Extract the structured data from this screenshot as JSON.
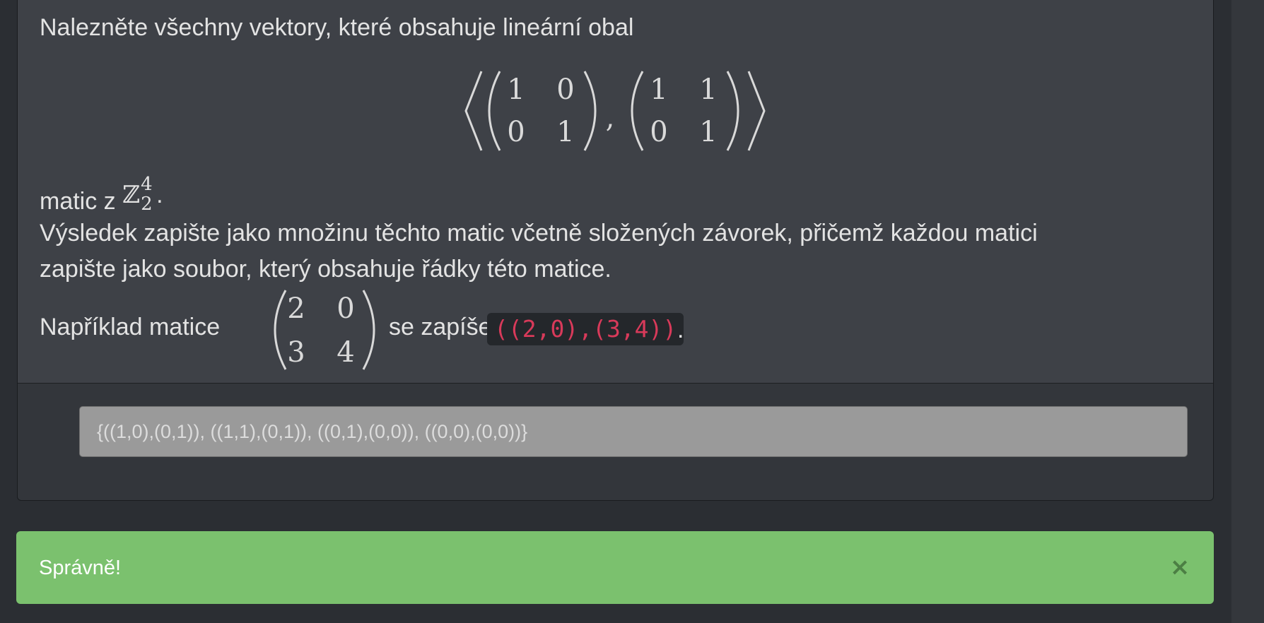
{
  "task": {
    "intro": "Nalezněte všechny vektory, které obsahuje lineární obal",
    "span": {
      "matrix_a": [
        [
          "1",
          "0"
        ],
        [
          "0",
          "1"
        ]
      ],
      "separator": ",",
      "matrix_b": [
        [
          "1",
          "1"
        ],
        [
          "0",
          "1"
        ]
      ]
    },
    "matic_text": "matic z ",
    "field_symbol": "ℤ",
    "field_sup": "4",
    "field_sub": "2",
    "field_dot": ".",
    "instruction_line1": "Výsledek zapište jako množinu těchto matic včetně složených závorek, přičemž každou matici",
    "instruction_line2": "zapište jako soubor, který obsahuje řádky této matice.",
    "example_prefix": "Například matice",
    "example_matrix": [
      [
        "2",
        "0"
      ],
      [
        "3",
        "4"
      ]
    ],
    "example_mid": "se zapíše",
    "example_code": "((2,0),(3,4))",
    "example_end": "."
  },
  "answer": {
    "value": "{((1,0),(0,1)), ((1,1),(0,1)), ((0,1),(0,0)), ((0,0),(0,0))}"
  },
  "feedback": {
    "message": "Správně!",
    "close_symbol": "×"
  },
  "colors": {
    "card_bg": "#3e4147",
    "page_bg": "#2b2e33",
    "success": "#7bc16e",
    "code_text": "#d83a5a"
  }
}
